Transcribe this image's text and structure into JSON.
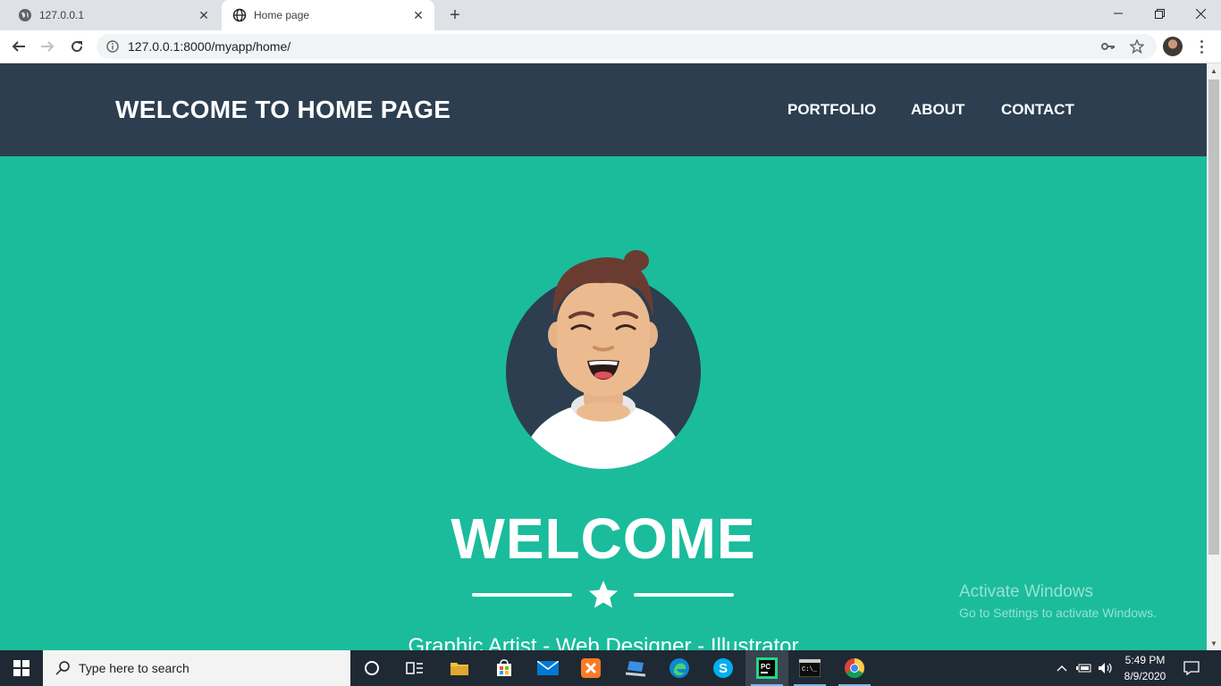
{
  "browser": {
    "tabs": [
      {
        "label": "127.0.0.1",
        "icon": "globe-gray-icon"
      },
      {
        "label": "Home page",
        "icon": "globe-icon"
      }
    ],
    "url": "127.0.0.1:8000/myapp/home/"
  },
  "page": {
    "brand": "WELCOME TO HOME PAGE",
    "nav": [
      "PORTFOLIO",
      "ABOUT",
      "CONTACT"
    ],
    "heading": "WELCOME",
    "subtitle": "Graphic Artist - Web Designer - Illustrator",
    "colors": {
      "navbar": "#2c3e50",
      "accent": "#1abc9c",
      "text": "#ffffff"
    }
  },
  "watermark": {
    "line1": "Activate Windows",
    "line2": "Go to Settings to activate Windows."
  },
  "taskbar": {
    "search_placeholder": "Type here to search",
    "time": "5:49 PM",
    "date": "8/9/2020",
    "apps": [
      "cortana-icon",
      "task-view-icon",
      "file-explorer-icon",
      "microsoft-store-icon",
      "mail-icon",
      "xampp-icon",
      "laptop-icon",
      "edge-icon",
      "skype-icon",
      "pycharm-icon",
      "terminal-icon",
      "chrome-icon"
    ]
  }
}
